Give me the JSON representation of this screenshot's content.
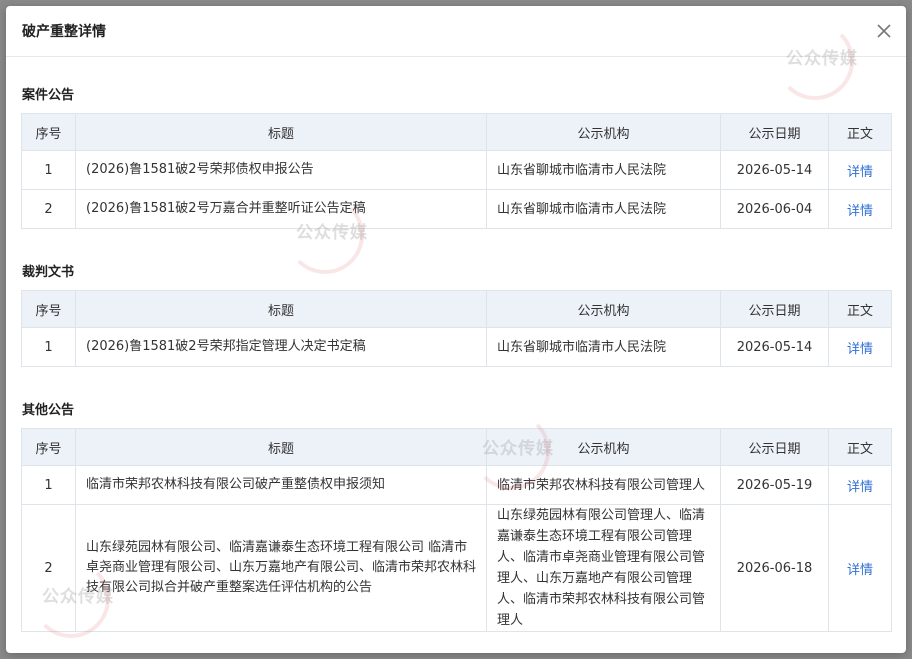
{
  "dialog": {
    "title": "破产重整详情"
  },
  "columns": {
    "idx": "序号",
    "title": "标题",
    "org": "公示机构",
    "date": "公示日期",
    "content": "正文"
  },
  "sections": [
    {
      "title": "案件公告",
      "rows": [
        {
          "idx": "1",
          "title": "(2026)鲁1581破2号荣邦债权申报公告",
          "org": "山东省聊城市临清市人民法院",
          "date": "2026-05-14",
          "link": "详情"
        },
        {
          "idx": "2",
          "title": "(2026)鲁1581破2号万嘉合并重整听证公告定稿",
          "org": "山东省聊城市临清市人民法院",
          "date": "2026-06-04",
          "link": "详情"
        }
      ]
    },
    {
      "title": "裁判文书",
      "rows": [
        {
          "idx": "1",
          "title": "(2026)鲁1581破2号荣邦指定管理人决定书定稿",
          "org": "山东省聊城市临清市人民法院",
          "date": "2026-05-14",
          "link": "详情"
        }
      ]
    },
    {
      "title": "其他公告",
      "rows": [
        {
          "idx": "1",
          "title": "临清市荣邦农林科技有限公司破产重整债权申报须知",
          "org": "临清市荣邦农林科技有限公司管理人",
          "date": "2026-05-19",
          "link": "详情"
        },
        {
          "idx": "2",
          "title": "山东绿苑园林有限公司、临清嘉谦泰生态环境工程有限公司 临清市卓尧商业管理有限公司、山东万嘉地产有限公司、临清市荣邦农林科技有限公司拟合并破产重整案选任评估机构的公告",
          "org": "山东绿苑园林有限公司管理人、临清嘉谦泰生态环境工程有限公司管理人、临清市卓尧商业管理有限公司管理人、山东万嘉地产有限公司管理人、临清市荣邦农林科技有限公司管理人",
          "date": "2026-06-18",
          "link": "详情"
        }
      ]
    }
  ],
  "watermark": {
    "text": "公众传媒"
  }
}
